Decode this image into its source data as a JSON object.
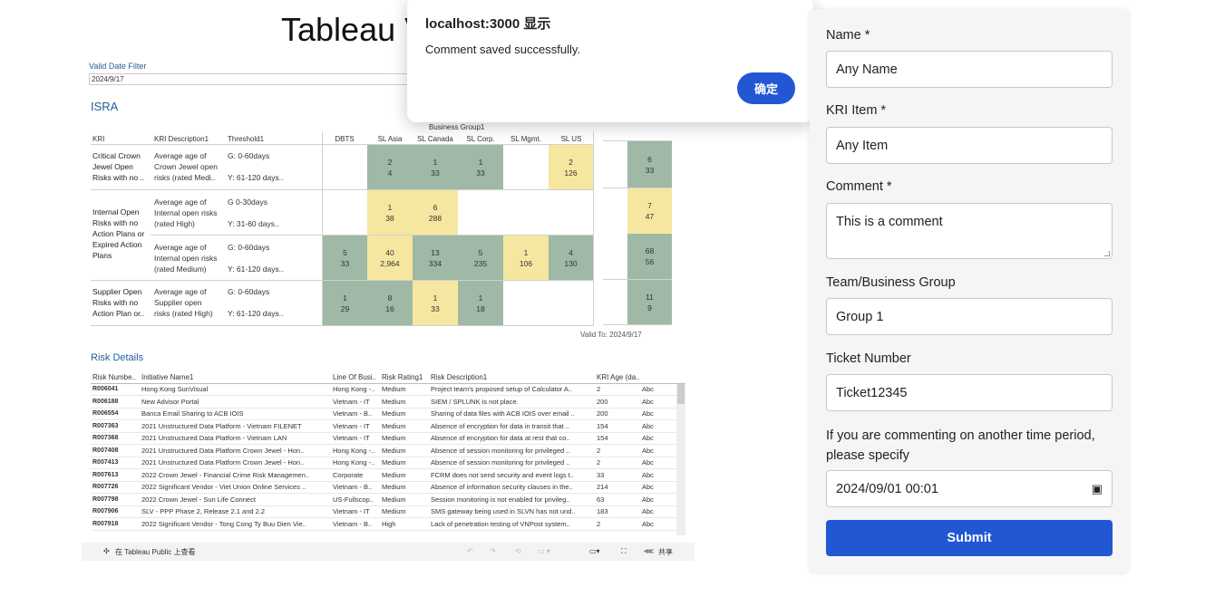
{
  "tableau": {
    "title": "Tableau V",
    "filter_label": "Valid Date Filter",
    "filter_value": "2024/9/17",
    "section_title": "ISRA",
    "business_group_header": "Business Group1",
    "row_headers": [
      "KRI",
      "KRI Description1",
      "Threshold1"
    ],
    "columns": [
      "DBTS",
      "SL Asia",
      "SL Canada",
      "SL Corp.",
      "SL Mgmt.",
      "SL US"
    ],
    "kri_names": [
      [
        "Critical Crown",
        "Jewel Open",
        "Risks with no .."
      ],
      [
        "Internal Open",
        "Risks with no",
        "Action Plans or",
        "Expired Action",
        "Plans"
      ],
      [
        "Supplier Open",
        "Risks with no",
        "Action Plan or.."
      ]
    ],
    "descriptions": [
      [
        "Average age of",
        "Crown Jewel open",
        "risks (rated Medi.."
      ],
      [
        "Average age of",
        "Internal open risks",
        "(rated High)"
      ],
      [
        "Average age of",
        "Internal open risks",
        "(rated Medium)"
      ],
      [
        "Average age of",
        "Supplier open",
        "risks (rated High)"
      ]
    ],
    "thresholds": [
      [
        "G: 0-60days",
        "Y: 61-120 days.."
      ],
      [
        "G 0-30days",
        "Y: 31-60 days.."
      ],
      [
        "G: 0-60days",
        "Y: 61-120 days.."
      ],
      [
        "G: 0-60days",
        "Y: 61-120 days.."
      ]
    ],
    "cells": {
      "r0c1": [
        "2",
        "4"
      ],
      "r0c2": [
        "1",
        "33"
      ],
      "r0c3": [
        "1",
        "33"
      ],
      "r0c5": [
        "2",
        "126"
      ],
      "r1c1": [
        "1",
        "38"
      ],
      "r1c2": [
        "6",
        "288"
      ],
      "r2c0": [
        "5",
        "33"
      ],
      "r2c1": [
        "40",
        "2,964"
      ],
      "r2c2": [
        "13",
        "334"
      ],
      "r2c3": [
        "5",
        "235"
      ],
      "r2c4": [
        "1",
        "106"
      ],
      "r2c5": [
        "4",
        "130"
      ],
      "r3c0": [
        "1",
        "29"
      ],
      "r3c1": [
        "8",
        "16"
      ],
      "r3c2": [
        "1",
        "33"
      ],
      "r3c3": [
        "1",
        "18"
      ]
    },
    "totals": [
      [
        "6",
        "33"
      ],
      [
        "7",
        "47"
      ],
      [
        "68",
        "56"
      ],
      [
        "11",
        "9"
      ]
    ],
    "valid_to": "Valid To: 2024/9/17",
    "risk_details_title": "Risk Details",
    "risk_table_headers": [
      "Risk Numbe..",
      "Initiative Name1",
      "Line Of Busi..",
      "Risk Rating1",
      "Risk Description1",
      "KRI Age (da..",
      ""
    ],
    "risk_rows": [
      [
        "R006041",
        "Hong Kong SunVisual",
        "Hong Kong -..",
        "Medium",
        "Project team's proposed setup of Calculator A..",
        "2",
        "Abc"
      ],
      [
        "R006188",
        "New Advisor Portal",
        "Vietnam - IT",
        "Medium",
        "SIEM / SPLUNK is not place.",
        "200",
        "Abc"
      ],
      [
        "R006554",
        "Banca Email Sharing to ACB IOIS",
        "Vietnam - B..",
        "Medium",
        "Sharing of data files with ACB IOIS over email ..",
        "200",
        "Abc"
      ],
      [
        "R007363",
        "2021 Unstructured Data Platform - Vietnam FILENET",
        "Vietnam - IT",
        "Medium",
        "Absence of encryption for data in transit that ..",
        "154",
        "Abc"
      ],
      [
        "R007368",
        "2021 Unstructured Data Platform  - Vietnam LAN",
        "Vietnam - IT",
        "Medium",
        "Absence of encryption for data at rest that co..",
        "154",
        "Abc"
      ],
      [
        "R007408",
        "2021 Unstructured Data Platform Crown Jewel - Hon..",
        "Hong Kong -..",
        "Medium",
        "Absence of session monitoring for privileged ..",
        "2",
        "Abc"
      ],
      [
        "R007413",
        "2021 Unstructured Data Platform Crown Jewel - Hon..",
        "Hong Kong -..",
        "Medium",
        "Absence of session monitoring for privileged ..",
        "2",
        "Abc"
      ],
      [
        "R007613",
        "2022 Crown Jewel - Financial Crime Risk Managemen..",
        "Corporate",
        "Medium",
        "FCRM does not send security and event logs t..",
        "33",
        "Abc"
      ],
      [
        "R007726",
        "2022 Significant Vendor - Viet Union Online Services ..",
        "Vietnam - B..",
        "Medium",
        "Absence of information security clauses in the..",
        "214",
        "Abc"
      ],
      [
        "R007798",
        "2022 Crown Jewel - Sun Life Connect",
        "US-Fullscop..",
        "Medium",
        "Session monitoring is not enabled for privileg..",
        "63",
        "Abc"
      ],
      [
        "R007906",
        "SLV - PPP Phase 2, Release 2.1 and 2.2",
        "Vietnam - IT",
        "Medium",
        "SMS gateway being used in SLVN has not und..",
        "183",
        "Abc"
      ],
      [
        "R007918",
        "2022 Significant Vendor - Tong Cong Ty Buu Dien Vie..",
        "Vietnam - B..",
        "High",
        "Lack of penetration testing of VNPost system..",
        "2",
        "Abc"
      ]
    ],
    "footer_link": "在 Tableau Public 上查看",
    "footer_share": "共享"
  },
  "dialog": {
    "title": "localhost:3000 显示",
    "message": "Comment saved successfully.",
    "ok_label": "确定"
  },
  "form": {
    "name_label": "Name *",
    "name_value": "Any Name",
    "kri_label": "KRI Item *",
    "kri_value": "Any Item",
    "comment_label": "Comment *",
    "comment_value": "This is a comment",
    "team_label": "Team/Business Group",
    "team_value": "Group 1",
    "ticket_label": "Ticket Number",
    "ticket_value": "Ticket12345",
    "period_label": "If you are commenting on another time period, please specify",
    "period_value": "2024/09/01 00:01",
    "submit_label": "Submit"
  },
  "colors": {
    "accent": "#2257d4",
    "green_cell": "#9fb9a6",
    "yellow_cell": "#f6e7a0"
  }
}
